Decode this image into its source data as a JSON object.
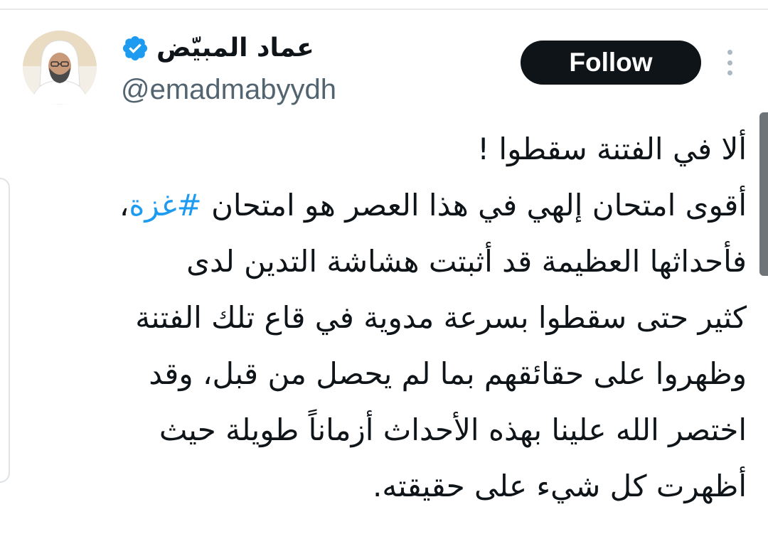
{
  "author": {
    "display_name": "عماد المبيّض",
    "handle": "@emadmabyydh",
    "verified": true,
    "verified_color": "#1d9bf0",
    "avatar_icon": "profile-photo"
  },
  "follow_button": {
    "label": "Follow",
    "background": "#0f1419",
    "text_color": "#ffffff"
  },
  "more_menu_icon": "vertical-ellipsis-icon",
  "tweet": {
    "title_line": "ألا في الفتنة سقطوا !",
    "line2_before_hashtag": "أقوى امتحان إلهي في هذا العصر هو امتحان ",
    "hashtag": "#غزة",
    "line2_after_hashtag": "،",
    "lines": [
      "فأحداثها العظيمة قد أثبتت هشاشة التدين لدى",
      "كثير حتى سقطوا بسرعة مدوية في قاع تلك الفتنة",
      "وظهروا على حقائقهم بما لم يحصل من قبل، وقد",
      "اختصر الله علينا بهذه الأحداث أزماناً طويلة حيث",
      "أظهرت كل شيء على حقيقته."
    ],
    "hashtag_color": "#1d9bf0"
  }
}
